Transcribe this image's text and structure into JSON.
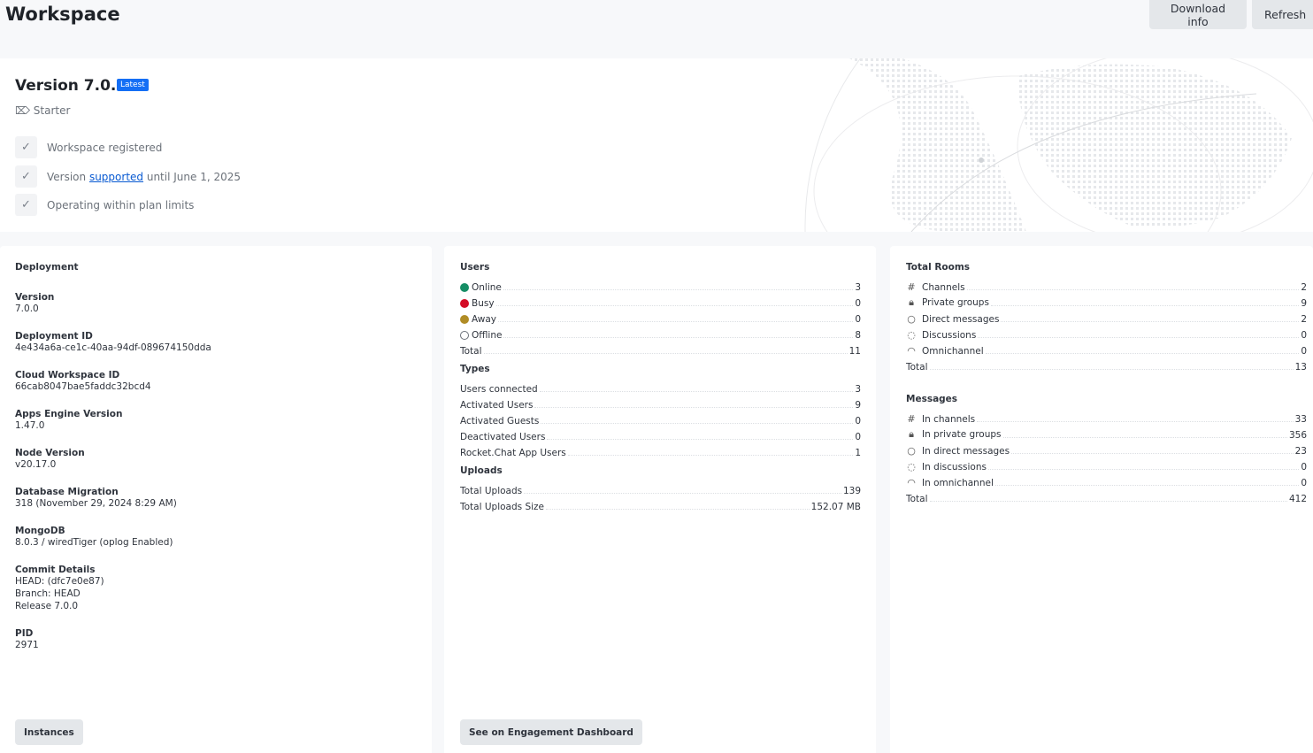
{
  "header": {
    "title": "Workspace",
    "download_label": "Download info",
    "refresh_label": "Refresh"
  },
  "version": {
    "title": "Version 7.0.0",
    "badge": "Latest",
    "plan": "Starter",
    "checks": {
      "registered": "Workspace registered",
      "supported_pre": "Version ",
      "supported_link": "supported",
      "supported_post": " until June 1, 2025",
      "limits": "Operating within plan limits"
    }
  },
  "deployment": {
    "title": "Deployment",
    "items": [
      {
        "label": "Version",
        "values": [
          "7.0.0"
        ]
      },
      {
        "label": "Deployment ID",
        "values": [
          "4e434a6a-ce1c-40aa-94df-089674150dda"
        ]
      },
      {
        "label": "Cloud Workspace ID",
        "values": [
          "66cab8047bae5faddc32bcd4"
        ]
      },
      {
        "label": "Apps Engine Version",
        "values": [
          "1.47.0"
        ]
      },
      {
        "label": "Node Version",
        "values": [
          "v20.17.0"
        ]
      },
      {
        "label": "Database Migration",
        "values": [
          "318 (November 29, 2024 8:29 AM)"
        ]
      },
      {
        "label": "MongoDB",
        "values": [
          "8.0.3 / wiredTiger (oplog Enabled)"
        ]
      },
      {
        "label": "Commit Details",
        "values": [
          "HEAD: (dfc7e0e87)",
          "Branch: HEAD",
          "Release 7.0.0"
        ]
      },
      {
        "label": "PID",
        "values": [
          "2971"
        ]
      }
    ],
    "button": "Instances"
  },
  "usage": {
    "sections": [
      {
        "title": "Users",
        "rows": [
          {
            "label": "Online",
            "value": "3",
            "icon": "status-online",
            "color": "#158d65"
          },
          {
            "label": "Busy",
            "value": "0",
            "icon": "status-busy",
            "color": "#d40c26"
          },
          {
            "label": "Away",
            "value": "0",
            "icon": "status-away",
            "color": "#b08c25"
          },
          {
            "label": "Offline",
            "value": "8",
            "icon": "status-offline",
            "color": "#6c727a"
          },
          {
            "label": "Total",
            "value": "11"
          }
        ]
      },
      {
        "title": "Types",
        "rows": [
          {
            "label": "Users connected",
            "value": "3"
          },
          {
            "label": "Activated Users",
            "value": "9"
          },
          {
            "label": "Activated Guests",
            "value": "0"
          },
          {
            "label": "Deactivated Users",
            "value": "0"
          },
          {
            "label": "Rocket.Chat App Users",
            "value": "1"
          }
        ]
      },
      {
        "title": "Uploads",
        "rows": [
          {
            "label": "Total Uploads",
            "value": "139"
          },
          {
            "label": "Total Uploads Size",
            "value": "152.07 MB"
          }
        ]
      }
    ],
    "button": "See on Engagement Dashboard"
  },
  "rooms": {
    "sections": [
      {
        "title": "Total Rooms",
        "rows": [
          {
            "label": "Channels",
            "value": "2",
            "icon": "hash"
          },
          {
            "label": "Private groups",
            "value": "9",
            "icon": "lock"
          },
          {
            "label": "Direct messages",
            "value": "2",
            "icon": "chat"
          },
          {
            "label": "Discussions",
            "value": "0",
            "icon": "discussion"
          },
          {
            "label": "Omnichannel",
            "value": "0",
            "icon": "headset"
          },
          {
            "label": "Total",
            "value": "13"
          }
        ]
      },
      {
        "title": "Messages",
        "rows": [
          {
            "label": "In channels",
            "value": "33",
            "icon": "hash"
          },
          {
            "label": "In private groups",
            "value": "356",
            "icon": "lock"
          },
          {
            "label": "In direct messages",
            "value": "23",
            "icon": "chat"
          },
          {
            "label": "In discussions",
            "value": "0",
            "icon": "discussion"
          },
          {
            "label": "In omnichannel",
            "value": "0",
            "icon": "headset"
          },
          {
            "label": "Total",
            "value": "412"
          }
        ]
      }
    ]
  }
}
